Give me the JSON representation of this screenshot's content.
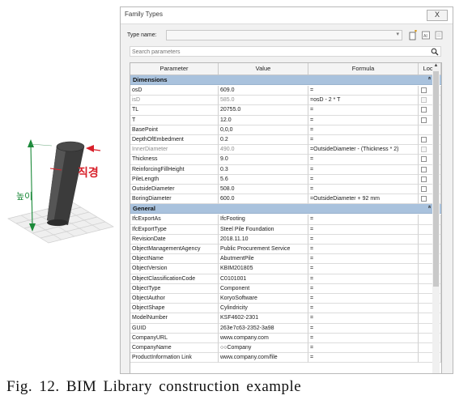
{
  "illustration": {
    "height_label": "높이",
    "diameter_label": "직경",
    "colors": {
      "pile": "#3a3a3a",
      "height_arrow": "#1c8a3a",
      "diameter_arrow": "#d8202a",
      "ground": "#c9c9c9"
    }
  },
  "dialog": {
    "title": "Family Types",
    "close_label": "X",
    "type_name_label": "Type name:",
    "type_name_value": "",
    "search_placeholder": "Search parameters",
    "columns": {
      "parameter": "Parameter",
      "value": "Value",
      "formula": "Formula",
      "lock": "Lock"
    },
    "groups": [
      {
        "name": "Dimensions",
        "chevron": "»",
        "rows": [
          {
            "parameter": "osD",
            "value": "609.0",
            "formula": "=",
            "lock": "checkbox",
            "dim": false
          },
          {
            "parameter": "isD",
            "value": "585.0",
            "formula": "=osD - 2 * T",
            "lock": "checkbox",
            "dim": true
          },
          {
            "parameter": "TL",
            "value": "20755.0",
            "formula": "=",
            "lock": "checkbox",
            "dim": false
          },
          {
            "parameter": "T",
            "value": "12.0",
            "formula": "=",
            "lock": "checkbox",
            "dim": false
          },
          {
            "parameter": "BasePoint",
            "value": "0,0,0",
            "formula": "=",
            "lock": "",
            "dim": false
          },
          {
            "parameter": "DepthOfEmbedment",
            "value": "0.2",
            "formula": "=",
            "lock": "checkbox",
            "dim": false
          },
          {
            "parameter": "InnerDiameter",
            "value": "490.0",
            "formula": "=OutsideDiameter - (Thickness * 2)",
            "lock": "checkbox",
            "dim": true
          },
          {
            "parameter": "Thickness",
            "value": "9.0",
            "formula": "=",
            "lock": "checkbox",
            "dim": false
          },
          {
            "parameter": "ReinforcingFillHeight",
            "value": "0.3",
            "formula": "=",
            "lock": "checkbox",
            "dim": false
          },
          {
            "parameter": "PileLength",
            "value": "5.6",
            "formula": "=",
            "lock": "checkbox",
            "dim": false
          },
          {
            "parameter": "OutsideDiameter",
            "value": "508.0",
            "formula": "=",
            "lock": "checkbox",
            "dim": false
          },
          {
            "parameter": "BoringDiameter",
            "value": "600.0",
            "formula": "=OutsideDiameter + 92 mm",
            "lock": "checkbox",
            "dim": false
          }
        ]
      },
      {
        "name": "General",
        "chevron": "»",
        "rows": [
          {
            "parameter": "IfcExportAs",
            "value": "IfcFooting",
            "formula": "=",
            "lock": "",
            "dim": false
          },
          {
            "parameter": "IfcExportType",
            "value": "Steel Pile Foundation",
            "formula": "=",
            "lock": "",
            "dim": false
          },
          {
            "parameter": "RevisionDate",
            "value": "2018.11.10",
            "formula": "=",
            "lock": "",
            "dim": false
          },
          {
            "parameter": "ObjectManagementAgency",
            "value": "Public Procurement Service",
            "formula": "=",
            "lock": "",
            "dim": false
          },
          {
            "parameter": "ObjectName",
            "value": "AbutmentPile",
            "formula": "=",
            "lock": "",
            "dim": false
          },
          {
            "parameter": "ObjectVersion",
            "value": "KBIM201805",
            "formula": "=",
            "lock": "",
            "dim": false
          },
          {
            "parameter": "ObjectClassificationCode",
            "value": "C0101001",
            "formula": "=",
            "lock": "",
            "dim": false
          },
          {
            "parameter": "ObjectType",
            "value": "Component",
            "formula": "=",
            "lock": "",
            "dim": false
          },
          {
            "parameter": "ObjectAuthor",
            "value": "KoryoSoftware",
            "formula": "=",
            "lock": "",
            "dim": false
          },
          {
            "parameter": "ObjectShape",
            "value": "Cylindricity",
            "formula": "=",
            "lock": "",
            "dim": false
          },
          {
            "parameter": "ModelNumber",
            "value": "KSF4602-2301",
            "formula": "=",
            "lock": "",
            "dim": false
          },
          {
            "parameter": "GUID",
            "value": "263e7c63-2352-3a98",
            "formula": "=",
            "lock": "",
            "dim": false
          },
          {
            "parameter": "CompanyURL",
            "value": "www.company.com",
            "formula": "=",
            "lock": "",
            "dim": false
          },
          {
            "parameter": "CompanyName",
            "value": "○○Company",
            "formula": "=",
            "lock": "",
            "dim": false
          },
          {
            "parameter": "ProductInformation Link",
            "value": "www.company.com/file",
            "formula": "=",
            "lock": "",
            "dim": false
          }
        ]
      }
    ]
  },
  "caption": "Fig. 12. BIM Library construction example"
}
